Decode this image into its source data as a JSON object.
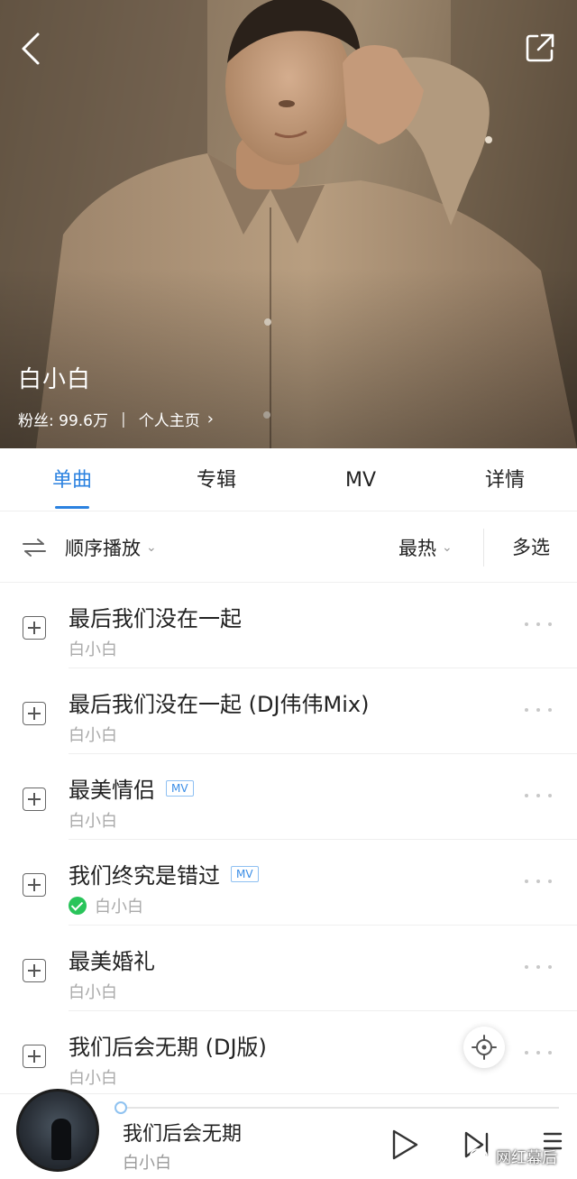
{
  "header": {
    "back_icon": "chevron-left-icon",
    "share_icon": "share-icon",
    "artist_name": "白小白",
    "fans_label": "粉丝: 99.6万",
    "separator": "|",
    "homepage_link": "个人主页",
    "homepage_chevron": "›"
  },
  "tabs": [
    {
      "label": "单曲",
      "active": true
    },
    {
      "label": "专辑",
      "active": false
    },
    {
      "label": "MV",
      "active": false
    },
    {
      "label": "详情",
      "active": false
    }
  ],
  "toolbar": {
    "order_icon": "sequential-play-icon",
    "order_label": "顺序播放",
    "sort_label": "最热",
    "caret": "⌄",
    "multi_select": "多选"
  },
  "songs": [
    {
      "title": "最后我们没在一起",
      "artist": "白小白",
      "mv": "",
      "downloaded": false
    },
    {
      "title": "最后我们没在一起 (DJ伟伟Mix)",
      "artist": "白小白",
      "mv": "",
      "downloaded": false
    },
    {
      "title": "最美情侣",
      "artist": "白小白",
      "mv": "MV",
      "downloaded": false
    },
    {
      "title": "我们终究是错过",
      "artist": "白小白",
      "mv": "MV",
      "downloaded": true
    },
    {
      "title": "最美婚礼",
      "artist": "白小白",
      "mv": "",
      "downloaded": false
    },
    {
      "title": "我们后会无期 (DJ版)",
      "artist": "白小白",
      "mv": "",
      "downloaded": false
    }
  ],
  "player": {
    "title": "我们后会无期",
    "artist": "白小白",
    "progress": 0.0,
    "watermark": "网红幕后"
  },
  "colors": {
    "accent": "#2b82e0",
    "downloaded": "#29c45a",
    "secondary_text": "#aaaaaa"
  }
}
